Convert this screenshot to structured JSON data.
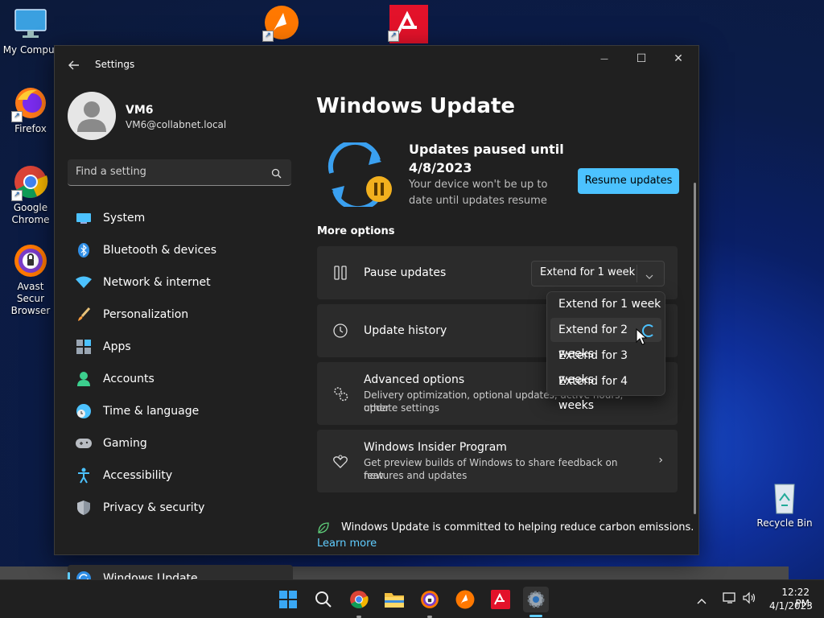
{
  "desktop": {
    "icons": [
      {
        "label": "My Comput"
      },
      {
        "label": "Firefox"
      },
      {
        "label": "Google Chrome"
      },
      {
        "label": "Avast Secur Browser"
      },
      {
        "label": "Recycle Bin"
      }
    ]
  },
  "window": {
    "title": "Settings",
    "controls": {
      "minimize": "—",
      "maximize": "☐",
      "close": "✕"
    }
  },
  "profile": {
    "name": "VM6",
    "email": "VM6@collabnet.local"
  },
  "search": {
    "placeholder": "Find a setting"
  },
  "nav": {
    "items": [
      {
        "label": "System",
        "icon": "system-icon"
      },
      {
        "label": "Bluetooth & devices",
        "icon": "bluetooth-icon"
      },
      {
        "label": "Network & internet",
        "icon": "wifi-icon"
      },
      {
        "label": "Personalization",
        "icon": "brush-icon"
      },
      {
        "label": "Apps",
        "icon": "apps-icon"
      },
      {
        "label": "Accounts",
        "icon": "accounts-icon"
      },
      {
        "label": "Time & language",
        "icon": "clock-globe-icon"
      },
      {
        "label": "Gaming",
        "icon": "gamepad-icon"
      },
      {
        "label": "Accessibility",
        "icon": "accessibility-icon"
      },
      {
        "label": "Privacy & security",
        "icon": "shield-icon"
      },
      {
        "label": "Windows Update",
        "icon": "update-icon"
      }
    ],
    "active_index": 10
  },
  "page": {
    "title": "Windows Update",
    "status": {
      "heading_line1": "Updates paused until",
      "heading_line2": "4/8/2023",
      "desc_line1": "Your device won't be up to",
      "desc_line2": "date until updates resume",
      "resume_button": "Resume updates"
    },
    "more_options": "More options",
    "pause": {
      "label": "Pause updates",
      "dropdown_value": "Extend for 1 week"
    },
    "history": {
      "label": "Update history"
    },
    "advanced": {
      "label": "Advanced options",
      "desc_line1": "Delivery optimization, optional updates, active hours, other",
      "desc_line2": "update settings"
    },
    "insider": {
      "label": "Windows Insider Program",
      "desc_line1": "Get preview builds of Windows to share feedback on new",
      "desc_line2": "features and updates"
    },
    "carbon": {
      "text": "Windows Update is committed to helping reduce carbon emissions.",
      "link": "Learn more"
    }
  },
  "dropdown_menu": {
    "options": [
      "Extend for 1 week",
      "Extend for 2 weeks",
      "Extend for 3 weeks",
      "Extend for 4 weeks"
    ],
    "hovered_index": 1
  },
  "taskbar": {
    "apps": [
      "start-icon",
      "search-icon",
      "chrome-icon",
      "file-explorer-icon",
      "avast-secure-browser-icon",
      "avast-icon",
      "avira-icon",
      "settings-icon"
    ],
    "clock": {
      "time": "12:22 PM",
      "date": "4/1/2023"
    }
  },
  "colors": {
    "accent": "#60cdff",
    "resume_button_bg": "#4cc2ff",
    "window_bg": "#202020",
    "card_bg": "#2b2b2b"
  }
}
